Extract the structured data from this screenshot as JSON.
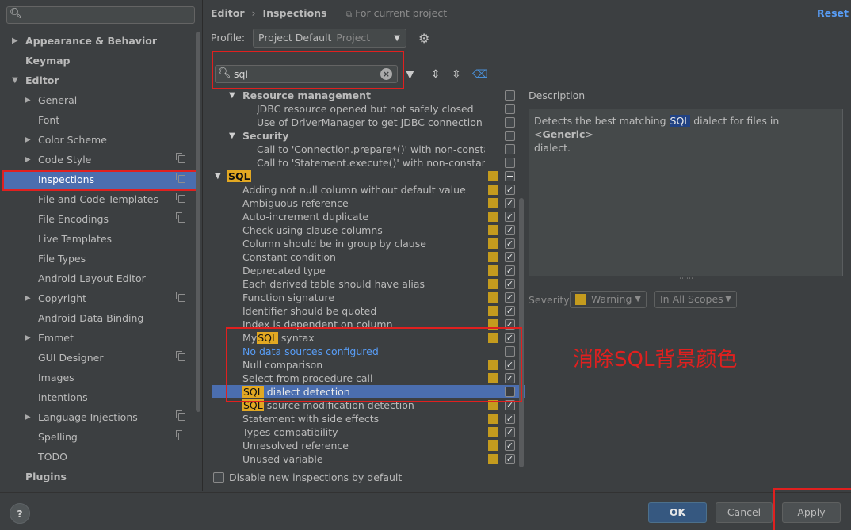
{
  "left_tree": {
    "search_placeholder": "",
    "items": [
      {
        "label": "Appearance & Behavior"
      },
      {
        "label": "Keymap"
      },
      {
        "label": "Editor"
      },
      {
        "label": "General"
      },
      {
        "label": "Font"
      },
      {
        "label": "Color Scheme"
      },
      {
        "label": "Code Style"
      },
      {
        "label": "Inspections"
      },
      {
        "label": "File and Code Templates"
      },
      {
        "label": "File Encodings"
      },
      {
        "label": "Live Templates"
      },
      {
        "label": "File Types"
      },
      {
        "label": "Android Layout Editor"
      },
      {
        "label": "Copyright"
      },
      {
        "label": "Android Data Binding"
      },
      {
        "label": "Emmet"
      },
      {
        "label": "GUI Designer"
      },
      {
        "label": "Images"
      },
      {
        "label": "Intentions"
      },
      {
        "label": "Language Injections"
      },
      {
        "label": "Spelling"
      },
      {
        "label": "TODO"
      },
      {
        "label": "Plugins"
      }
    ]
  },
  "header": {
    "crumb_editor": "Editor",
    "crumb_sep": "›",
    "crumb_inspections": "Inspections",
    "for_project": "For current project",
    "reset": "Reset"
  },
  "profile": {
    "label": "Profile:",
    "value": "Project Default",
    "scope": "Project"
  },
  "search": {
    "query": "sql"
  },
  "inspections": {
    "resource_management": "Resource management",
    "jdbc_not_closed": "JDBC resource opened but not safely closed",
    "driver_manager": "Use of DriverManager to get JDBC connection",
    "security": "Security",
    "call_prepare": "Call to 'Connection.prepare*()' with non-constant s",
    "call_execute": "Call to 'Statement.execute()' with non-constant stri",
    "sql_group": "SQL",
    "items": [
      "Adding not null column without default value",
      "Ambiguous reference",
      "Auto-increment duplicate",
      "Check using clause columns",
      "Column should be in group by clause",
      "Constant condition",
      "Deprecated type",
      "Each derived table should have alias",
      "Function signature",
      "Identifier should be quoted",
      "Index is dependent on column"
    ],
    "mysql_pre": "My",
    "mysql_hl": "SQL",
    "mysql_post": " syntax",
    "no_data_sources": "No data sources configured",
    "null_comparison": "Null comparison",
    "select_from_procedure": "Select from procedure call",
    "dialect_hl": "SQL",
    "dialect_post": " dialect detection",
    "source_hl": "SQL",
    "source_post": " source modification detection",
    "items2": [
      "Statement with side effects",
      "Types compatibility",
      "Unresolved reference",
      "Unused variable"
    ]
  },
  "description": {
    "label": "Description",
    "text_pre": "Detects the best matching ",
    "text_hl": "SQL",
    "text_mid": " dialect for files in <",
    "text_bold": "Generic",
    "text_post": ">",
    "text_line2": "dialect."
  },
  "severity": {
    "label": "Severity:",
    "value": "Warning",
    "scope": "In All Scopes",
    "color": "#c49b1e"
  },
  "annotation": "消除SQL背景颜色",
  "bottom": {
    "disable_label": "Disable new inspections by default",
    "help": "?",
    "ok": "OK",
    "cancel": "Cancel",
    "apply": "Apply"
  }
}
